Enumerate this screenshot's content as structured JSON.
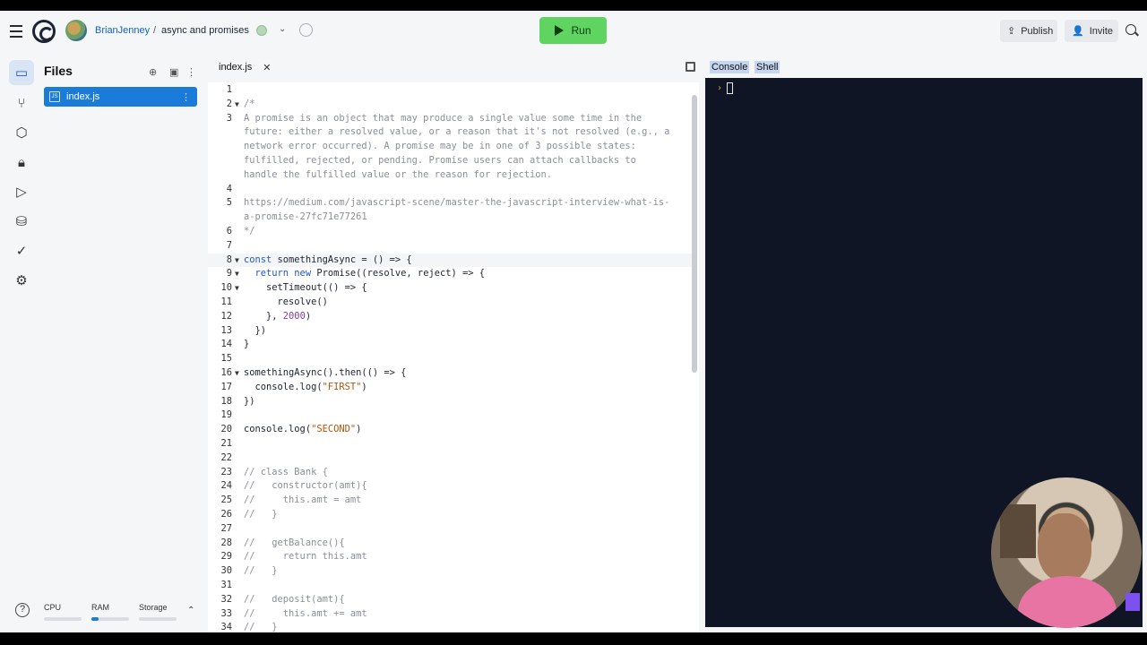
{
  "topbar": {
    "user": "BrianJenney",
    "separator": "/",
    "repl_name": "async and promises",
    "run_label": "Run",
    "publish_label": "Publish",
    "invite_label": "Invite"
  },
  "files": {
    "title": "Files",
    "items": [
      {
        "name": "index.js",
        "badge": "JS"
      }
    ]
  },
  "resources": [
    {
      "label": "CPU",
      "level": 0
    },
    {
      "label": "RAM",
      "level": 0.2
    },
    {
      "label": "Storage",
      "level": 0
    }
  ],
  "editor": {
    "tab": "index.js",
    "lines": [
      {
        "n": "1",
        "segs": []
      },
      {
        "n": "2",
        "fold": true,
        "segs": [
          [
            "c-com",
            "/*"
          ]
        ]
      },
      {
        "n": "3",
        "segs": [
          [
            "c-com",
            "A promise is an object that may produce a single value some time in the"
          ]
        ]
      },
      {
        "n": "",
        "segs": [
          [
            "c-com",
            "future: either a resolved value, or a reason that it's not resolved (e.g., a"
          ]
        ]
      },
      {
        "n": "",
        "segs": [
          [
            "c-com",
            "network error occurred). A promise may be in one of 3 possible states:"
          ]
        ]
      },
      {
        "n": "",
        "segs": [
          [
            "c-com",
            "fulfilled, rejected, or pending. Promise users can attach callbacks to"
          ]
        ]
      },
      {
        "n": "",
        "segs": [
          [
            "c-com",
            "handle the fulfilled value or the reason for rejection."
          ]
        ]
      },
      {
        "n": "4",
        "segs": []
      },
      {
        "n": "5",
        "segs": [
          [
            "c-com",
            "https://medium.com/javascript-scene/master-the-javascript-interview-what-is-"
          ]
        ]
      },
      {
        "n": "",
        "segs": [
          [
            "c-com",
            "a-promise-27fc71e77261"
          ]
        ]
      },
      {
        "n": "6",
        "segs": [
          [
            "c-com",
            "*/"
          ]
        ]
      },
      {
        "n": "7",
        "segs": []
      },
      {
        "n": "8",
        "fold": true,
        "cursor": true,
        "segs": [
          [
            "c-key",
            "const"
          ],
          [
            "c-def",
            " somethingAsync = () => {"
          ]
        ]
      },
      {
        "n": "9",
        "fold": true,
        "segs": [
          [
            "c-def",
            "  "
          ],
          [
            "c-key",
            "return new"
          ],
          [
            "c-def",
            " Promise((resolve, reject) => {"
          ]
        ]
      },
      {
        "n": "10",
        "fold": true,
        "segs": [
          [
            "c-def",
            "    setTimeout(() => {"
          ]
        ]
      },
      {
        "n": "11",
        "segs": [
          [
            "c-def",
            "      resolve()"
          ]
        ]
      },
      {
        "n": "12",
        "segs": [
          [
            "c-def",
            "    }, "
          ],
          [
            "c-num",
            "2000"
          ],
          [
            "c-def",
            ")"
          ]
        ]
      },
      {
        "n": "13",
        "segs": [
          [
            "c-def",
            "  })"
          ]
        ]
      },
      {
        "n": "14",
        "segs": [
          [
            "c-def",
            "}"
          ]
        ]
      },
      {
        "n": "15",
        "segs": []
      },
      {
        "n": "16",
        "fold": true,
        "segs": [
          [
            "c-def",
            "somethingAsync().then(() => {"
          ]
        ]
      },
      {
        "n": "17",
        "segs": [
          [
            "c-def",
            "  console.log("
          ],
          [
            "c-str",
            "\"FIRST\""
          ],
          [
            "c-def",
            ")"
          ]
        ]
      },
      {
        "n": "18",
        "segs": [
          [
            "c-def",
            "})"
          ]
        ]
      },
      {
        "n": "19",
        "segs": []
      },
      {
        "n": "20",
        "segs": [
          [
            "c-def",
            "console.log("
          ],
          [
            "c-str",
            "\"SECOND\""
          ],
          [
            "c-def",
            ")"
          ]
        ]
      },
      {
        "n": "21",
        "segs": []
      },
      {
        "n": "22",
        "segs": []
      },
      {
        "n": "23",
        "segs": [
          [
            "c-com",
            "// class Bank {"
          ]
        ]
      },
      {
        "n": "24",
        "segs": [
          [
            "c-com",
            "//   constructor(amt){"
          ]
        ]
      },
      {
        "n": "25",
        "segs": [
          [
            "c-com",
            "//     this.amt = amt"
          ]
        ]
      },
      {
        "n": "26",
        "segs": [
          [
            "c-com",
            "//   }"
          ]
        ]
      },
      {
        "n": "27",
        "segs": []
      },
      {
        "n": "28",
        "segs": [
          [
            "c-com",
            "//   getBalance(){"
          ]
        ]
      },
      {
        "n": "29",
        "segs": [
          [
            "c-com",
            "//     return this.amt"
          ]
        ]
      },
      {
        "n": "30",
        "segs": [
          [
            "c-com",
            "//   }"
          ]
        ]
      },
      {
        "n": "31",
        "segs": []
      },
      {
        "n": "32",
        "segs": [
          [
            "c-com",
            "//   deposit(amt){"
          ]
        ]
      },
      {
        "n": "33",
        "segs": [
          [
            "c-com",
            "//     this.amt += amt"
          ]
        ]
      },
      {
        "n": "34",
        "segs": [
          [
            "c-com",
            "//   }"
          ]
        ]
      }
    ]
  },
  "console": {
    "tabs": [
      "Console",
      "Shell"
    ],
    "prompt": "›"
  },
  "icons": {
    "rail": [
      "files-icon",
      "version-control-icon",
      "packages-icon",
      "secrets-icon",
      "run-icon",
      "database-icon",
      "checks-icon",
      "settings-icon"
    ]
  }
}
